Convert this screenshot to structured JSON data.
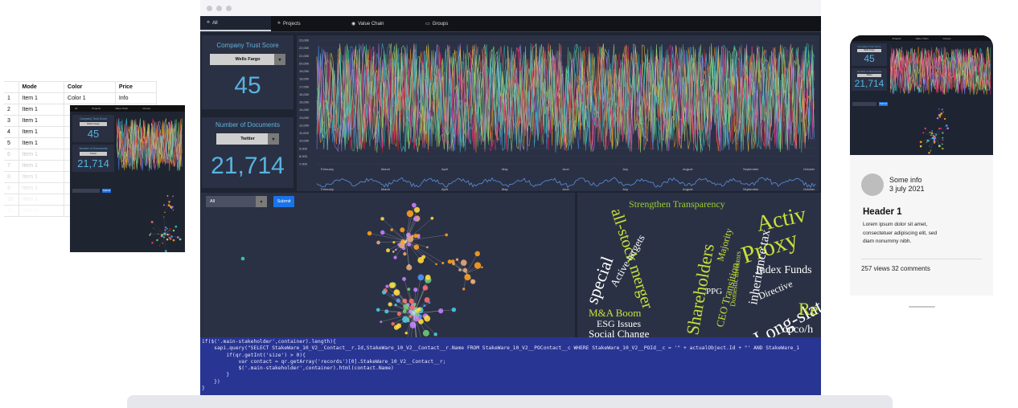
{
  "spreadsheet": {
    "headers": [
      "",
      "Mode",
      "Color",
      "Price"
    ],
    "rows": [
      [
        "1",
        "Item 1",
        "Color 1",
        "Info"
      ],
      [
        "2",
        "Item 1",
        "",
        ""
      ],
      [
        "3",
        "Item 1",
        "",
        ""
      ],
      [
        "4",
        "Item 1",
        "",
        ""
      ],
      [
        "5",
        "Item 1",
        "",
        ""
      ],
      [
        "6",
        "Item 1",
        "",
        ""
      ],
      [
        "7",
        "Item 1",
        "",
        ""
      ],
      [
        "8",
        "Item 1",
        "",
        ""
      ],
      [
        "9",
        "Item 1",
        "",
        ""
      ],
      [
        "10",
        "Item 1",
        "",
        ""
      ],
      [
        "11",
        "Item 1",
        "",
        ""
      ]
    ]
  },
  "mini": {
    "tabs": [
      "All",
      "Projects",
      "Value Chain",
      "Groups"
    ],
    "trust_title": "Company Trust Score",
    "trust_select": "Wells Fargo",
    "trust_value": "45",
    "docs_title": "Number of Documents",
    "docs_select": "Twitter",
    "docs_value": "21,714",
    "submit": "Submit"
  },
  "main": {
    "tabs": [
      {
        "label": "All",
        "icon": "network-icon"
      },
      {
        "label": "Projects",
        "icon": "network-icon"
      },
      {
        "label": "Value Chain",
        "icon": "globe-icon"
      },
      {
        "label": "Groups",
        "icon": "laptop-icon"
      }
    ],
    "trust_card": {
      "title": "Company Trust Score",
      "select": "Wells Fargo",
      "value": "45"
    },
    "docs_card": {
      "title": "Number of Documents",
      "select": "Twitter",
      "value": "21,714"
    },
    "network": {
      "filter": "All",
      "submit": "Submit"
    },
    "chart": {
      "y_ticks": [
        "23,000",
        "22,000",
        "21,000",
        "20,000",
        "19,000",
        "18,000",
        "17,000",
        "16,000",
        "15,000",
        "14,000",
        "13,000",
        "12,000",
        "11,000",
        "10,000",
        "9,000",
        "8,000",
        "7,000"
      ],
      "x_ticks": [
        "February",
        "March",
        "April",
        "May",
        "June",
        "July",
        "August",
        "September",
        "October"
      ],
      "x_ticks_overview": [
        "February",
        "March",
        "April",
        "May",
        "June",
        "July",
        "August",
        "September",
        "October"
      ]
    },
    "word_cloud": [
      {
        "text": "Strengthen Transparency",
        "color": "#9acd32"
      },
      {
        "text": "Activ",
        "color": "#c6e03a"
      },
      {
        "text": "Proxy",
        "color": "#c6e03a"
      },
      {
        "text": "all-stock merger",
        "color": "#c6e03a"
      },
      {
        "text": "special",
        "color": "#ffffff"
      },
      {
        "text": "Shareholders",
        "color": "#c6e03a"
      },
      {
        "text": "inheritance tax",
        "color": "#ffffff"
      },
      {
        "text": "Index Funds",
        "color": "#ffffff"
      },
      {
        "text": "Long-slate",
        "color": "#ffffff"
      },
      {
        "text": "M&A Boom",
        "color": "#c6e03a"
      },
      {
        "text": "ESG Issues",
        "color": "#ffffff"
      },
      {
        "text": "Social Change",
        "color": "#ffffff"
      },
      {
        "text": "opco/h",
        "color": "#ffffff"
      },
      {
        "text": "Re",
        "color": "#c6e03a"
      },
      {
        "text": "CEO Transition",
        "color": "#c6e03a"
      },
      {
        "text": "Active targets",
        "color": "#ffffff"
      },
      {
        "text": "Majority",
        "color": "#c6e03a"
      },
      {
        "text": "Directive",
        "color": "#ffffff"
      },
      {
        "text": "PPG",
        "color": "#ffffff"
      },
      {
        "text": "Domestic investors",
        "color": "#c6e03a"
      }
    ],
    "code_lines": [
      "if($('.main-stakeholder',container).length){",
      "    sapi.query(\"SELECT StakeWare_10_V2__Contact__r.Id,StakeWare_10_V2__Contact__r.Name FROM StakeWare_10_V2__POContact__c WHERE StakeWare_10_V2__POId__c = '\" + actualObject.Id + \"' AND StakeWare_1",
      "        if(qr.getInt('size') > 0){",
      "            var contact = qr.getArray('records')[0].StakeWare_10_V2__Contact__r;",
      "            $('.main-stakeholder',container).html(contact.Name)",
      "        }",
      "    })",
      "}"
    ]
  },
  "phone": {
    "tabs": [
      "Projects",
      "Value Chain",
      "Groups"
    ],
    "trust_title": "Company Trust Score",
    "trust_select": "Wells Fargo",
    "trust_value": "45",
    "docs_title": "Number of Documents",
    "docs_select": "Twitter",
    "docs_value": "21,714",
    "submit": "Submit",
    "meta_line1": "Some info",
    "meta_line2": "3 july 2021",
    "header": "Header 1",
    "lorem_1": "Lorem ipsum dolor sit amet,",
    "lorem_2": "consectetuer adipiscing elit, sed",
    "lorem_3": "diam nonummy nibh.",
    "stats": "257 views 32 comments"
  },
  "colors": {
    "dashboard_bg": "#1f2432",
    "panel_bg": "#2b3144",
    "accent_blue": "#56b3e0",
    "code_bg": "#283593",
    "submit_blue": "#1a73e8"
  }
}
